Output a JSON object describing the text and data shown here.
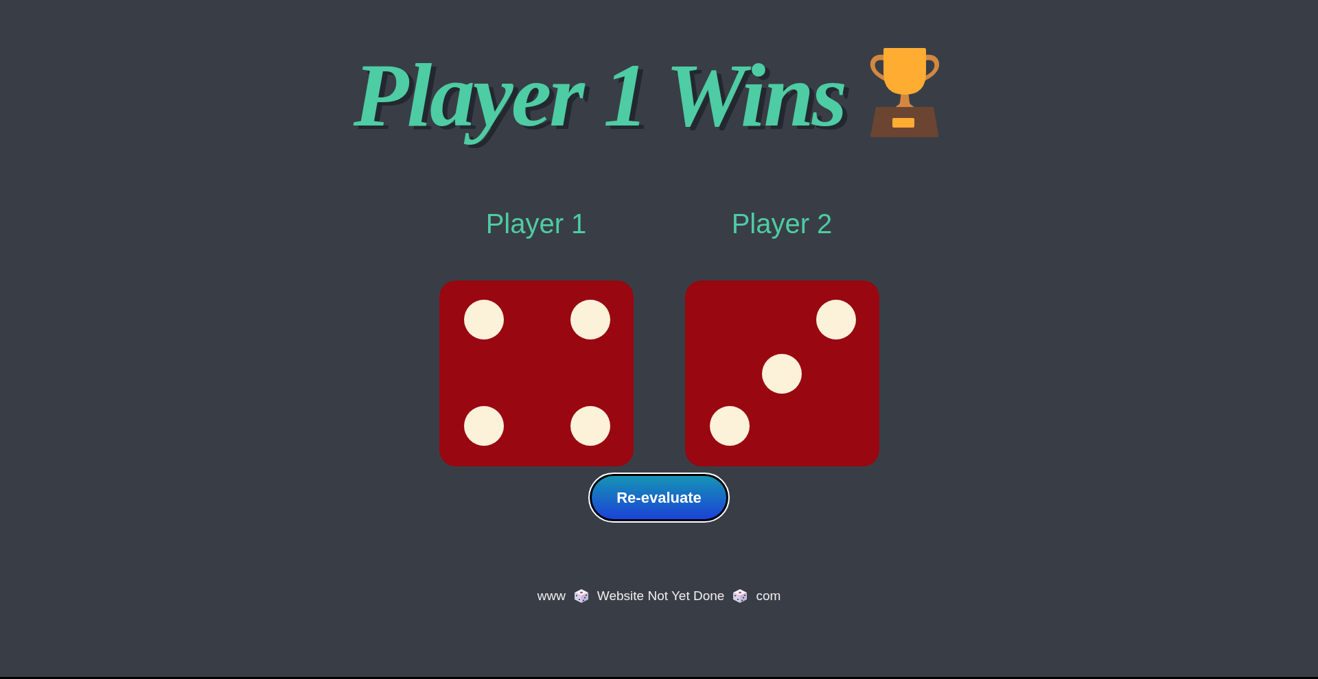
{
  "title": {
    "text": "Player 1 Wins"
  },
  "players": [
    {
      "name": "Player 1",
      "die": {
        "kind": "four"
      }
    },
    {
      "name": "Player 2",
      "die": {
        "kind": "three"
      }
    }
  ],
  "button": {
    "label": "Re-evaluate"
  },
  "footer": {
    "left": "www",
    "center": "Website Not Yet Done",
    "right": "com"
  }
}
